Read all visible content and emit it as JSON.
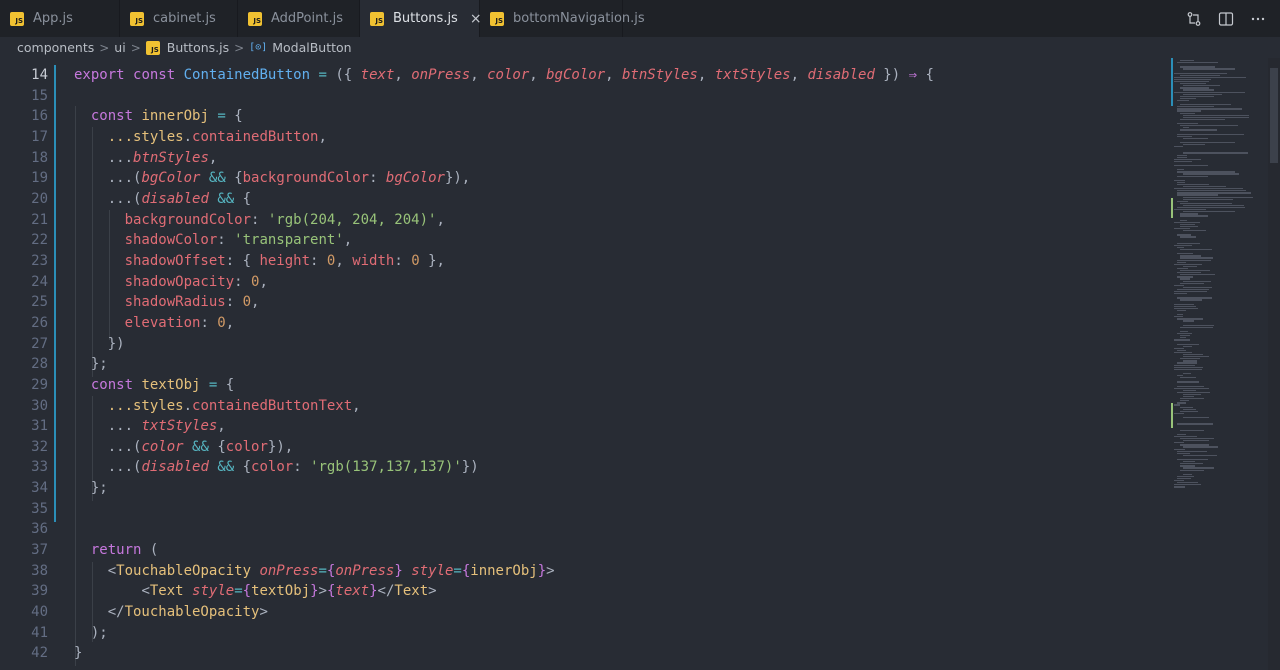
{
  "tabs": [
    {
      "label": "App.js",
      "active": false
    },
    {
      "label": "cabinet.js",
      "active": false
    },
    {
      "label": "AddPoint.js",
      "active": false
    },
    {
      "label": "Buttons.js",
      "active": true
    },
    {
      "label": "bottomNavigation.js",
      "active": false
    }
  ],
  "tab_icon_text": "JS",
  "tab_close_glyph": "×",
  "tab_actions": [
    "source-control-icon",
    "split-editor-icon",
    "more-actions-icon"
  ],
  "breadcrumb": {
    "segments": [
      "components",
      "ui",
      "Buttons.js",
      "ModalButton"
    ],
    "separator": ">"
  },
  "editor": {
    "language": "javascript",
    "current_line": 14,
    "lines": [
      {
        "n": "14",
        "text": "export const ContainedButton = ({ text, onPress, color, bgColor, btnStyles, txtStyles, disabled }) ⇒ {"
      },
      {
        "n": "15",
        "text": ""
      },
      {
        "n": "16",
        "text": "  const innerObj = {"
      },
      {
        "n": "17",
        "text": "    ...styles.containedButton,"
      },
      {
        "n": "18",
        "text": "    ...btnStyles,"
      },
      {
        "n": "19",
        "text": "    ...(bgColor && {backgroundColor: bgColor}),"
      },
      {
        "n": "20",
        "text": "    ...(disabled && {"
      },
      {
        "n": "21",
        "text": "      backgroundColor: 'rgb(204, 204, 204)',"
      },
      {
        "n": "22",
        "text": "      shadowColor: 'transparent',"
      },
      {
        "n": "23",
        "text": "      shadowOffset: { height: 0, width: 0 },"
      },
      {
        "n": "24",
        "text": "      shadowOpacity: 0,"
      },
      {
        "n": "25",
        "text": "      shadowRadius: 0,"
      },
      {
        "n": "26",
        "text": "      elevation: 0,"
      },
      {
        "n": "27",
        "text": "    })"
      },
      {
        "n": "28",
        "text": "  };"
      },
      {
        "n": "29",
        "text": "  const textObj = {"
      },
      {
        "n": "30",
        "text": "    ...styles.containedButtonText,"
      },
      {
        "n": "31",
        "text": "    ...txtStyles,"
      },
      {
        "n": "32",
        "text": "    ...(color && {color}),"
      },
      {
        "n": "33",
        "text": "    ...(disabled && {color: 'rgb(137,137,137)'})"
      },
      {
        "n": "34",
        "text": "  };"
      },
      {
        "n": "35",
        "text": ""
      },
      {
        "n": "36",
        "text": ""
      },
      {
        "n": "37",
        "text": "  return ("
      },
      {
        "n": "38",
        "text": "    <TouchableOpacity onPress={onPress} style={innerObj}>"
      },
      {
        "n": "39",
        "text": "        <Text style={textObj}>{text}</Text>"
      },
      {
        "n": "40",
        "text": "    </TouchableOpacity>"
      },
      {
        "n": "41",
        "text": "  );"
      },
      {
        "n": "42",
        "text": "}"
      }
    ]
  },
  "colors": {
    "background": "#282c34",
    "tab_background": "#1f2227",
    "keyword": "#c678dd",
    "function": "#61afef",
    "parameter": "#e06c75",
    "string": "#98c379",
    "number": "#d19a66",
    "variable": "#e5c07b",
    "operator": "#56b6c2",
    "modified_bar": "#2b8fb8",
    "js_badge": "#f1c232"
  }
}
